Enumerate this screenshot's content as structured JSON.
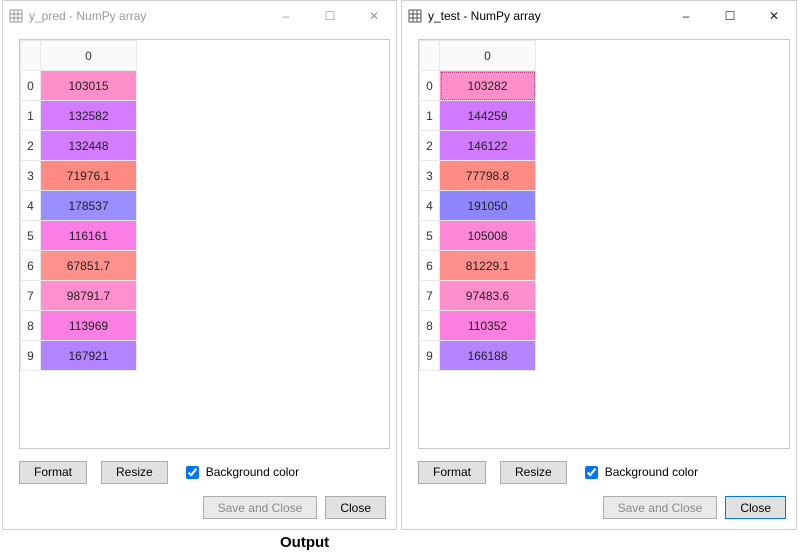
{
  "output_label": "Output",
  "checkbox_label": "Background color",
  "format_label": "Format",
  "resize_label": "Resize",
  "save_close_label": "Save and Close",
  "close_label": "Close",
  "col_header": "0",
  "windows": {
    "left": {
      "title": "y_pred - NumPy array",
      "active": false,
      "rows": [
        {
          "idx": "0",
          "val": "103015",
          "color": "#ff8fc8"
        },
        {
          "idx": "1",
          "val": "132582",
          "color": "#d47bff"
        },
        {
          "idx": "2",
          "val": "132448",
          "color": "#d37cff"
        },
        {
          "idx": "3",
          "val": "71976.1",
          "color": "#ff8a84"
        },
        {
          "idx": "4",
          "val": "178537",
          "color": "#9a8eff"
        },
        {
          "idx": "5",
          "val": "116161",
          "color": "#fa7ee6"
        },
        {
          "idx": "6",
          "val": "67851.7",
          "color": "#ff918c"
        },
        {
          "idx": "7",
          "val": "98791.7",
          "color": "#ff8fcd"
        },
        {
          "idx": "8",
          "val": "113969",
          "color": "#fb7ee2"
        },
        {
          "idx": "9",
          "val": "167921",
          "color": "#b284ff"
        }
      ]
    },
    "right": {
      "title": "y_test - NumPy array",
      "active": true,
      "rows": [
        {
          "idx": "0",
          "val": "103282",
          "color": "#ff8ec9"
        },
        {
          "idx": "1",
          "val": "144259",
          "color": "#d27aff"
        },
        {
          "idx": "2",
          "val": "146122",
          "color": "#cf7aff"
        },
        {
          "idx": "3",
          "val": "77798.8",
          "color": "#ff8b85"
        },
        {
          "idx": "4",
          "val": "191050",
          "color": "#8f86ff"
        },
        {
          "idx": "5",
          "val": "105008",
          "color": "#ff87d7"
        },
        {
          "idx": "6",
          "val": "81229.1",
          "color": "#ff8f8b"
        },
        {
          "idx": "7",
          "val": "97483.6",
          "color": "#ff8fcc"
        },
        {
          "idx": "8",
          "val": "110352",
          "color": "#fc7ede"
        },
        {
          "idx": "9",
          "val": "166188",
          "color": "#b585ff"
        }
      ]
    }
  },
  "chart_data": [
    {
      "type": "table",
      "title": "y_pred - NumPy array",
      "categories": [
        "0"
      ],
      "series": [
        {
          "name": "0",
          "values": [
            103015,
            132582,
            132448,
            71976.1,
            178537,
            116161,
            67851.7,
            98791.7,
            113969,
            167921
          ]
        }
      ]
    },
    {
      "type": "table",
      "title": "y_test - NumPy array",
      "categories": [
        "0"
      ],
      "series": [
        {
          "name": "0",
          "values": [
            103282,
            144259,
            146122,
            77798.8,
            191050,
            105008,
            81229.1,
            97483.6,
            110352,
            166188
          ]
        }
      ]
    }
  ]
}
